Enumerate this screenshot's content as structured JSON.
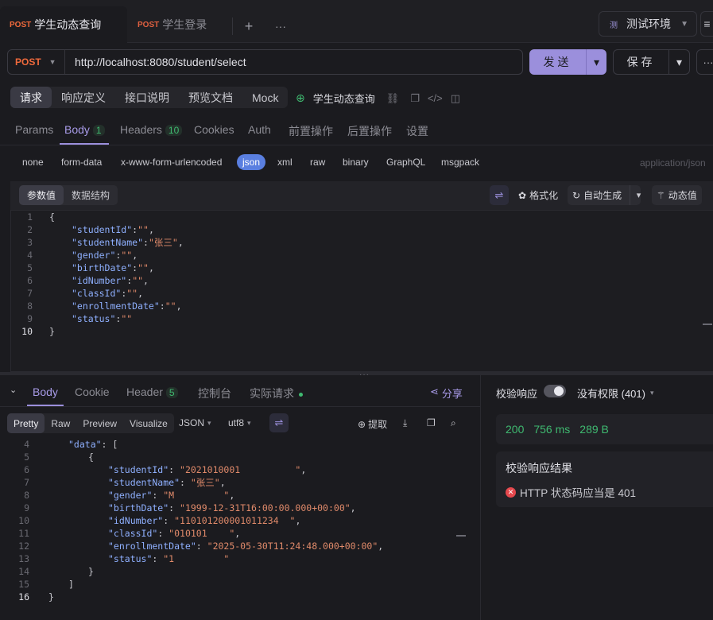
{
  "tabs": [
    {
      "method": "POST",
      "label": "学生动态查询",
      "active": true
    },
    {
      "method": "POST",
      "label": "学生登录",
      "active": false
    }
  ],
  "env": {
    "badge": "测",
    "label": "测试环境"
  },
  "request": {
    "method": "POST",
    "url": "http://localhost:8080/student/select",
    "send_label": "发送",
    "save_label": "保存"
  },
  "subtoolbar": {
    "segments": [
      "请求",
      "响应定义",
      "接口说明",
      "预览文档",
      "Mock"
    ],
    "api_name": "学生动态查询"
  },
  "param_tabs": [
    {
      "label": "Params"
    },
    {
      "label": "Body",
      "count": "1"
    },
    {
      "label": "Headers",
      "count": "10"
    },
    {
      "label": "Cookies"
    },
    {
      "label": "Auth"
    },
    {
      "label": "前置操作"
    },
    {
      "label": "后置操作"
    },
    {
      "label": "设置"
    }
  ],
  "body_types": [
    "none",
    "form-data",
    "x-www-form-urlencoded",
    "json",
    "xml",
    "raw",
    "binary",
    "GraphQL",
    "msgpack"
  ],
  "content_type": "application/json",
  "editor": {
    "segments": [
      "参数值",
      "数据结构"
    ],
    "format_label": "格式化",
    "autogen_label": "自动生成",
    "dynamic_label": "动态值"
  },
  "request_body_lines": [
    {
      "n": "1",
      "indent": 0,
      "text": "{"
    },
    {
      "n": "2",
      "indent": 1,
      "key": "\"studentId\"",
      "val": "\"\"",
      "end": ","
    },
    {
      "n": "3",
      "indent": 1,
      "key": "\"studentName\"",
      "val": "\"张三\"",
      "end": ","
    },
    {
      "n": "4",
      "indent": 1,
      "key": "\"gender\"",
      "val": "\"\"",
      "end": ","
    },
    {
      "n": "5",
      "indent": 1,
      "key": "\"birthDate\"",
      "val": "\"\"",
      "end": ","
    },
    {
      "n": "6",
      "indent": 1,
      "key": "\"idNumber\"",
      "val": "\"\"",
      "end": ","
    },
    {
      "n": "7",
      "indent": 1,
      "key": "\"classId\"",
      "val": "\"\"",
      "end": ","
    },
    {
      "n": "8",
      "indent": 1,
      "key": "\"enrollmentDate\"",
      "val": "\"\"",
      "end": ","
    },
    {
      "n": "9",
      "indent": 1,
      "key": "\"status\"",
      "val": "\"\"",
      "end": ""
    },
    {
      "n": "10",
      "indent": 0,
      "text": "}",
      "current": true
    }
  ],
  "response_tabs": [
    {
      "label": "Body"
    },
    {
      "label": "Cookie"
    },
    {
      "label": "Header",
      "count": "5"
    },
    {
      "label": "控制台"
    },
    {
      "label": "实际请求"
    }
  ],
  "share_label": "分享",
  "response_view": {
    "segments": [
      "Pretty",
      "Raw",
      "Preview",
      "Visualize"
    ],
    "format": "JSON",
    "encoding": "utf8",
    "extract_label": "提取"
  },
  "response_lines": [
    {
      "n": "4",
      "indent": 1,
      "key": "\"data\"",
      "sep": ": ",
      "rest": "["
    },
    {
      "n": "5",
      "indent": 2,
      "text": "{"
    },
    {
      "n": "6",
      "indent": 3,
      "key": "\"studentId\"",
      "sep": ": ",
      "val": "\"2021010001          \"",
      "end": ","
    },
    {
      "n": "7",
      "indent": 3,
      "key": "\"studentName\"",
      "sep": ": ",
      "val": "\"张三\"",
      "end": ","
    },
    {
      "n": "8",
      "indent": 3,
      "key": "\"gender\"",
      "sep": ": ",
      "val": "\"M         \"",
      "end": ","
    },
    {
      "n": "9",
      "indent": 3,
      "key": "\"birthDate\"",
      "sep": ": ",
      "val": "\"1999-12-31T16:00:00.000+00:00\"",
      "end": ","
    },
    {
      "n": "10",
      "indent": 3,
      "key": "\"idNumber\"",
      "sep": ": ",
      "val": "\"110101200001011234  \"",
      "end": ","
    },
    {
      "n": "11",
      "indent": 3,
      "key": "\"classId\"",
      "sep": ": ",
      "val": "\"010101    \"",
      "end": ","
    },
    {
      "n": "12",
      "indent": 3,
      "key": "\"enrollmentDate\"",
      "sep": ": ",
      "val": "\"2025-05-30T11:24:48.000+00:00\"",
      "end": ","
    },
    {
      "n": "13",
      "indent": 3,
      "key": "\"status\"",
      "sep": ": ",
      "val": "\"1         \"",
      "end": ""
    },
    {
      "n": "14",
      "indent": 2,
      "text": "}"
    },
    {
      "n": "15",
      "indent": 1,
      "text": "]"
    },
    {
      "n": "16",
      "indent": 0,
      "text": "}",
      "current": true
    }
  ],
  "validation": {
    "label": "校验响应",
    "permission": "没有权限 (401)",
    "status_code": "200",
    "time": "756 ms",
    "size": "289 B",
    "result_title": "校验响应结果",
    "result_item": "HTTP 状态码应当是 401"
  },
  "colors": {
    "accent": "#9b8fdc",
    "method": "#f06a3c",
    "success": "#3fb970",
    "error": "#e5484d"
  }
}
